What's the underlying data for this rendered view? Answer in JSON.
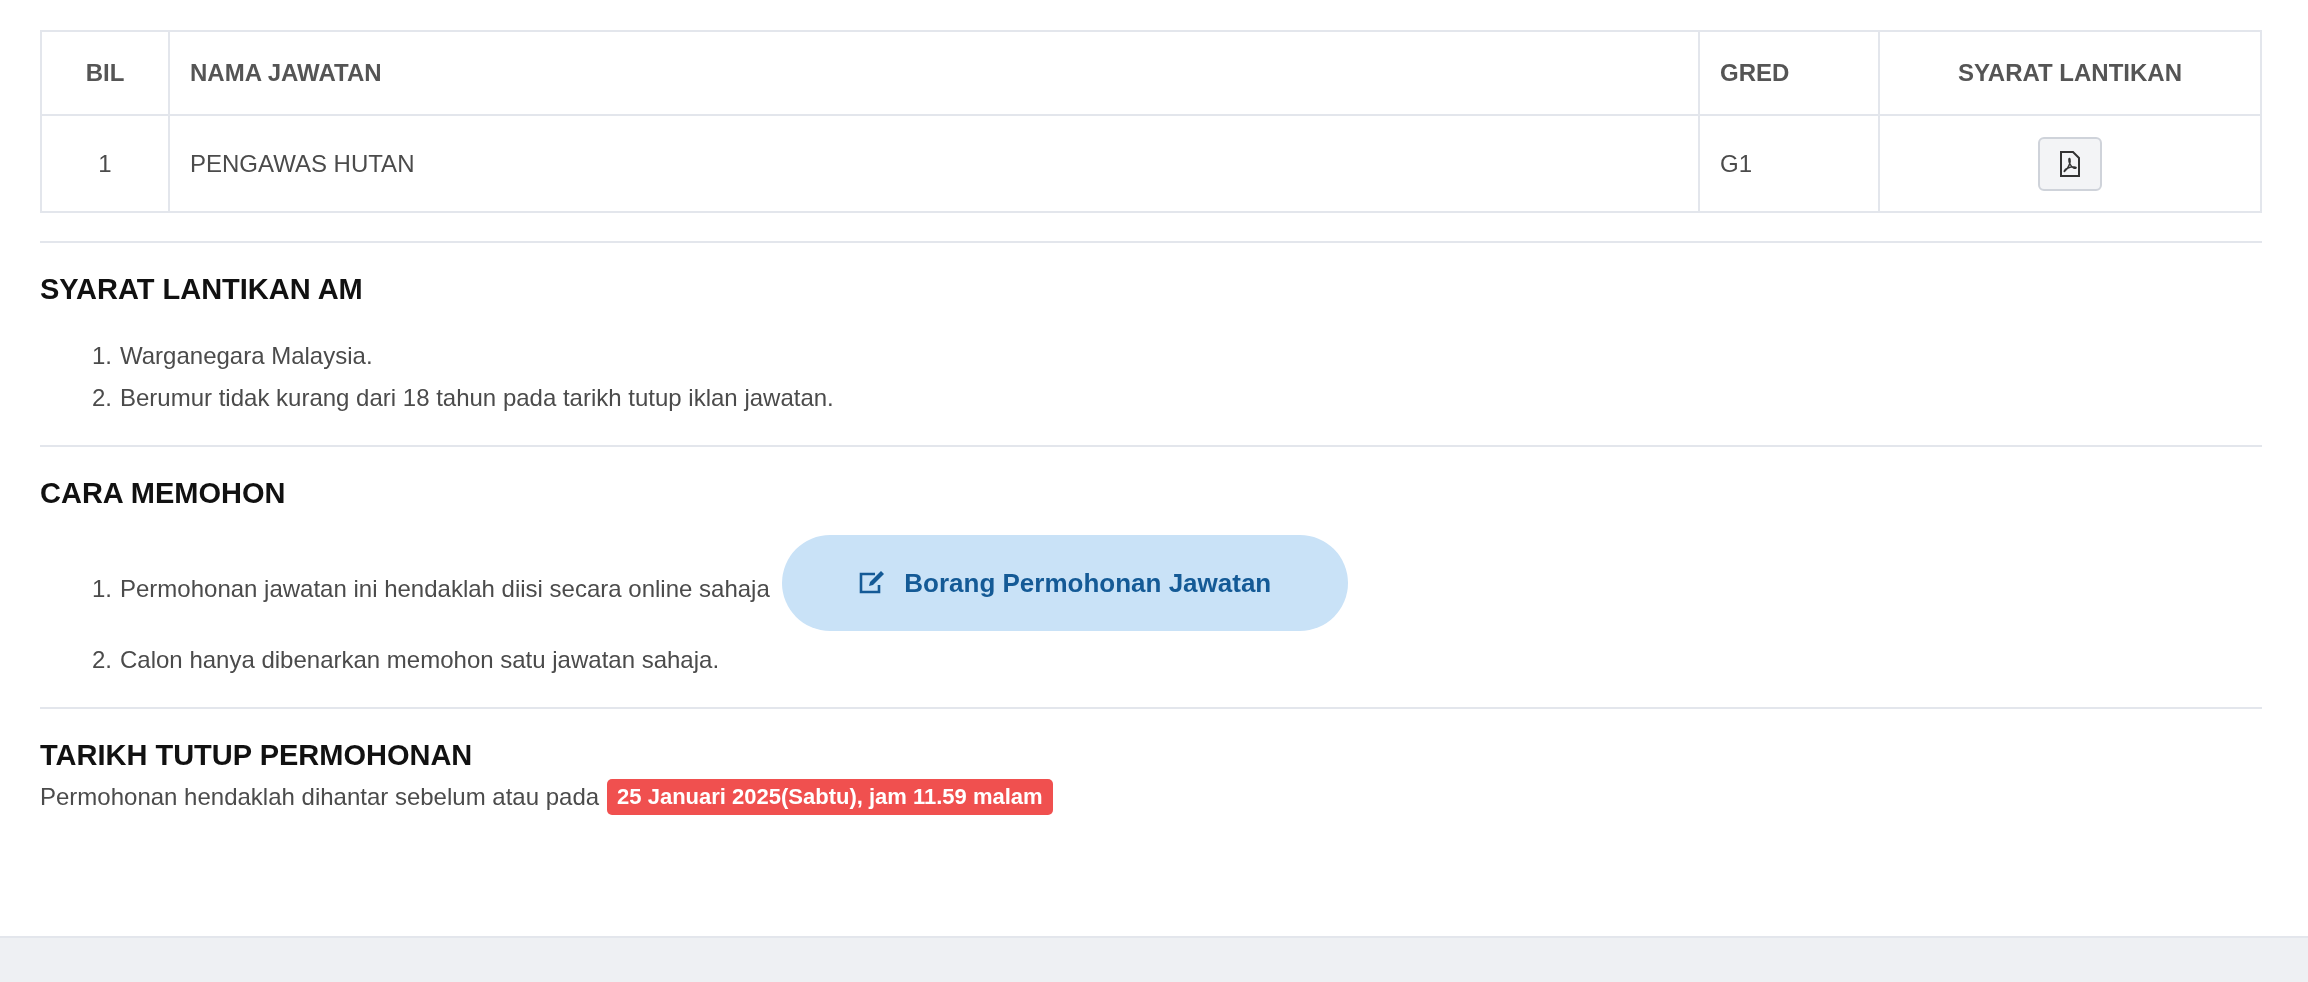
{
  "table": {
    "columns": [
      "BIL",
      "NAMA JAWATAN",
      "GRED",
      "SYARAT LANTIKAN"
    ],
    "rows": [
      {
        "bil": "1",
        "nama": "PENGAWAS HUTAN",
        "gred": "G1"
      }
    ]
  },
  "general_requirements": {
    "title": "SYARAT LANTIKAN AM",
    "items": [
      {
        "number": "1.",
        "text": "Warganegara Malaysia."
      },
      {
        "number": "2.",
        "text": "Berumur tidak kurang dari 18 tahun pada tarikh tutup iklan jawatan."
      }
    ]
  },
  "how_to_apply": {
    "title": "CARA MEMOHON",
    "items": [
      {
        "number": "1.",
        "text": "Permohonan jawatan ini hendaklah diisi secara online sahaja",
        "button": "Borang Permohonan Jawatan"
      },
      {
        "number": "2.",
        "text": "Calon hanya dibenarkan memohon satu jawatan sahaja."
      }
    ]
  },
  "closing_date": {
    "title": "TARIKH TUTUP PERMOHONAN",
    "text": "Permohonan hendaklah dihantar sebelum atau pada",
    "date_badge": "25 Januari 2025(Sabtu), jam 11.59 malam"
  }
}
